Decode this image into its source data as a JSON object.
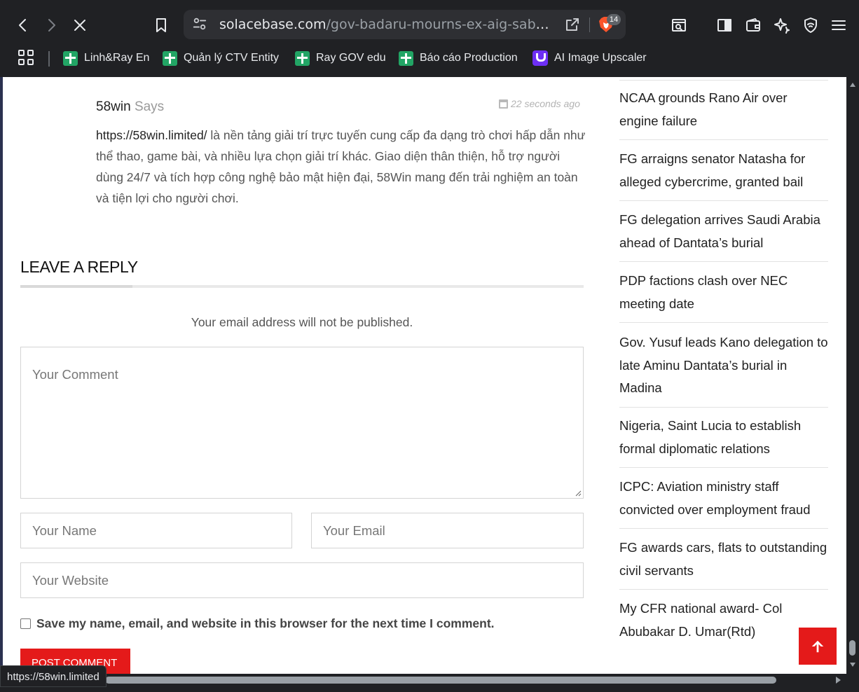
{
  "browser": {
    "url_host": "solacebase.com",
    "url_path": "/gov-badaru-mourns-ex-aig-sabo-ibra...",
    "shields_count": "14",
    "bookmarks": [
      {
        "label": "Linh&Ray En",
        "icon": "sheets-icon"
      },
      {
        "label": "Quản lý CTV Entity",
        "icon": "sheets-icon"
      },
      {
        "label": "Ray GOV edu",
        "icon": "sheets-icon"
      },
      {
        "label": "Báo cáo Production",
        "icon": "sheets-icon"
      },
      {
        "label": "AI Image Upscaler",
        "icon": "upscaler-icon"
      }
    ],
    "status_url": "https://58win.limited"
  },
  "comment": {
    "author": "58win",
    "says": "Says",
    "time": "22 seconds ago",
    "link_text": "https://58win.limited/",
    "body": " là nền tảng giải trí trực tuyến cung cấp đa dạng trò chơi hấp dẫn như thể thao, game bài, và nhiều lựa chọn giải trí khác. Giao diện thân thiện, hỗ trợ người dùng 24/7 và tích hợp công nghệ bảo mật hiện đại, 58Win mang đến trải nghiệm an toàn và tiện lợi cho người chơi."
  },
  "reply": {
    "title": "LEAVE A REPLY",
    "email_note": "Your email address will not be published.",
    "comment_placeholder": "Your Comment",
    "name_placeholder": "Your Name",
    "email_placeholder": "Your Email",
    "website_placeholder": "Your Website",
    "save_label": "Save my name, email, and website in this browser for the next time I comment.",
    "submit_label": "Post Comment"
  },
  "sidebar": {
    "items": [
      {
        "title": "NCAA grounds Rano Air over engine failure"
      },
      {
        "title": "FG arraigns senator Natasha for alleged cybercrime, granted bail"
      },
      {
        "title": "FG delegation arrives Saudi Arabia ahead of Dantata’s burial"
      },
      {
        "title": "PDP factions clash over NEC meeting date"
      },
      {
        "title": "Gov. Yusuf leads Kano delegation to late Aminu Dantata’s burial in Madina"
      },
      {
        "title": "Nigeria, Saint Lucia to establish formal diplomatic relations"
      },
      {
        "title": "ICPC: Aviation ministry staff convicted over employment fraud"
      },
      {
        "title": "FG awards cars, flats to outstanding civil servants"
      },
      {
        "title": "My CFR national award- Col Abubakar D. Umar(Rtd)"
      }
    ]
  },
  "colors": {
    "accent_red": "#e41a1a",
    "chrome_bg": "#202124"
  }
}
